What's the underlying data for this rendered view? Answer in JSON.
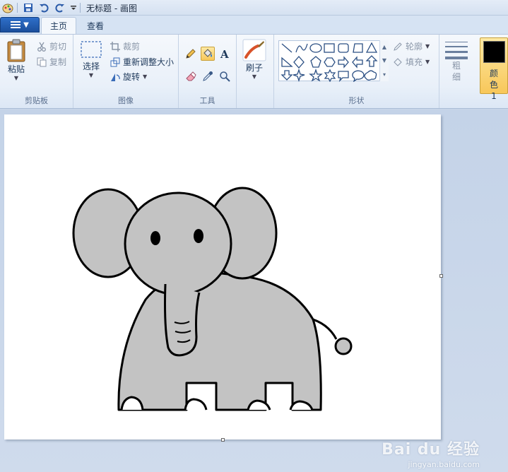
{
  "window": {
    "title": "无标题 - 画图"
  },
  "quick_access": {
    "icons": [
      "paint-app-icon",
      "save-icon",
      "undo-icon",
      "redo-icon",
      "customize-dropdown-icon"
    ]
  },
  "tabs": [
    {
      "label": "主页",
      "active": true
    },
    {
      "label": "查看",
      "active": false
    }
  ],
  "ribbon": {
    "clipboard": {
      "label": "剪贴板",
      "paste": "粘贴",
      "cut": "剪切",
      "copy": "复制"
    },
    "image": {
      "label": "图像",
      "select": "选择",
      "crop": "裁剪",
      "resize": "重新调整大小",
      "rotate": "旋转"
    },
    "tools": {
      "label": "工具",
      "active_tool": "fill"
    },
    "brushes": {
      "label": "刷子"
    },
    "shapes": {
      "label": "形状",
      "outline": "轮廓",
      "fill": "填充"
    },
    "size": {
      "label": "粗细"
    },
    "color1": {
      "label": "颜色 1",
      "value": "#000000"
    }
  },
  "canvas": {
    "drawing": "elephant",
    "colors": {
      "body": "#c3c3c3",
      "outline": "#000000",
      "background": "#ffffff"
    }
  },
  "watermark": {
    "brand": "Bai du 经验",
    "url": "jingyan.baidu.com"
  },
  "colors": {
    "accent": "#1b4f9c",
    "selected": "#f8c75a"
  }
}
